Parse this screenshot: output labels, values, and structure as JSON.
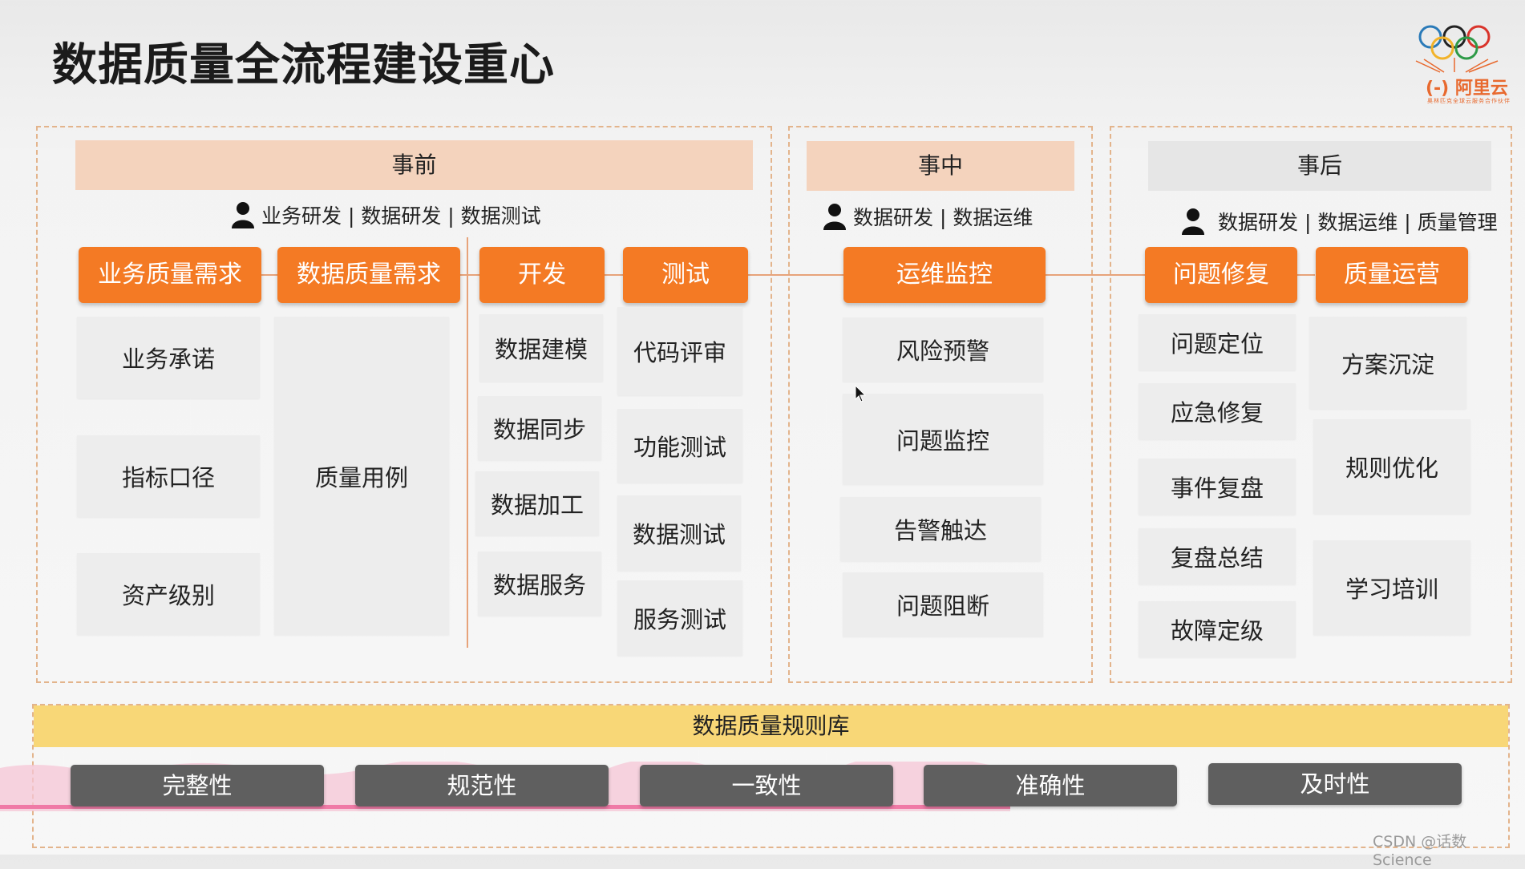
{
  "title": "数据质量全流程建设重心",
  "logo": {
    "brand": "阿里云",
    "tagline": "奥林匹克全球云服务合作伙伴"
  },
  "phases": {
    "before": {
      "header": "事前",
      "roles": "业务研发 | 数据研发 | 数据测试",
      "stages": [
        "业务质量需求",
        "数据质量需求",
        "开发",
        "测试"
      ],
      "business_items": [
        "业务承诺",
        "指标口径",
        "资产级别"
      ],
      "data_item": "质量用例",
      "dev_items": [
        "数据建模",
        "数据同步",
        "数据加工",
        "数据服务"
      ],
      "test_items": [
        "代码评审",
        "功能测试",
        "数据测试",
        "服务测试"
      ]
    },
    "during": {
      "header": "事中",
      "roles": "数据研发 | 数据运维",
      "stage": "运维监控",
      "items": [
        "风险预警",
        "问题监控",
        "告警触达",
        "问题阻断"
      ]
    },
    "after": {
      "header": "事后",
      "roles": "数据研发 | 数据运维 | 质量管理",
      "stages": [
        "问题修复",
        "质量运营"
      ],
      "fix_items": [
        "问题定位",
        "应急修复",
        "事件复盘",
        "复盘总结",
        "故障定级"
      ],
      "ops_items": [
        "方案沉淀",
        "规则优化",
        "学习培训"
      ]
    }
  },
  "rules": {
    "header": "数据质量规则库",
    "items": [
      "完整性",
      "规范性",
      "一致性",
      "准确性",
      "及时性"
    ]
  },
  "colors": {
    "accent": "#f47a24",
    "before_header": "#f4d3bd",
    "during_header": "#f4d3bd",
    "after_header": "#e6e6e6",
    "rules_header": "#f8d777",
    "rule_button": "#5f5f5f"
  },
  "watermark": "CSDN @话数Science"
}
